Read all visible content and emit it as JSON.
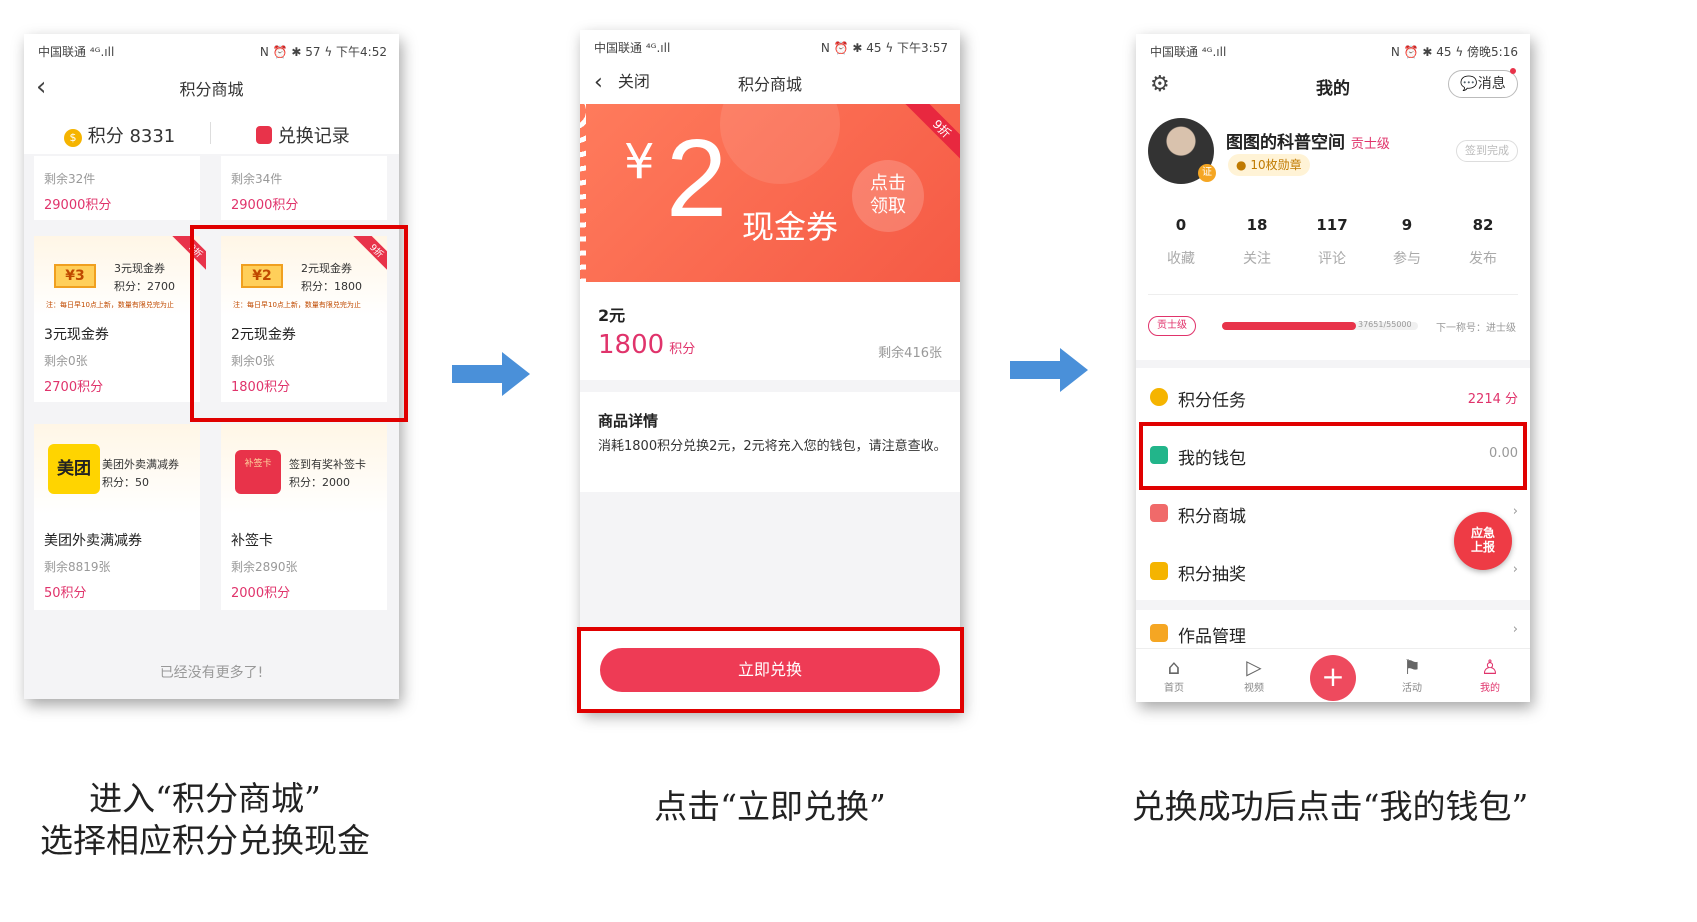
{
  "phone1": {
    "status_left": "中国联通 ⁴ᴳ.ıll",
    "status_right": "N ⏰ ✱ 57 ϟ 下午4:52",
    "title": "积分商城",
    "points_label": "积分 8331",
    "records_label": "兑换记录",
    "top_cells": [
      {
        "remain": "剩余32件",
        "price": "29000积分"
      },
      {
        "remain": "剩余34件",
        "price": "29000积分"
      }
    ],
    "items": [
      {
        "ticket": "¥3",
        "img_title": "3元现金券",
        "img_points": "积分：2700",
        "img_note": "注：每日早10点上新，数量有限兑完为止",
        "name": "3元现金券",
        "remain": "剩余0张",
        "price": "2700积分",
        "tag": "9折"
      },
      {
        "ticket": "¥2",
        "img_title": "2元现金券",
        "img_points": "积分：1800",
        "img_note": "注：每日早10点上新，数量有限兑完为止",
        "name": "2元现金券",
        "remain": "剩余0张",
        "price": "1800积分",
        "tag": "9折"
      },
      {
        "logo": "美团",
        "img_title": "美团外卖满减券",
        "img_points": "积分：50",
        "name": "美团外卖满减券",
        "remain": "剩余8819张",
        "price": "50积分"
      },
      {
        "card_label": "补签卡",
        "img_title": "签到有奖补签卡",
        "img_points": "积分：2000",
        "name": "补签卡",
        "remain": "剩余2890张",
        "price": "2000积分"
      }
    ],
    "end_text": "已经没有更多了!"
  },
  "phone2": {
    "status_left": "中国联通 ⁴ᴳ.ıll",
    "status_right": "N ⏰ ✱ 45 ϟ 下午3:57",
    "close_label": "关闭",
    "title": "积分商城",
    "banner_yen": "¥",
    "banner_amount": "2",
    "banner_text": "现金券",
    "banner_click_line1": "点击",
    "banner_click_line2": "领取",
    "banner_tag": "9折",
    "item_name": "2元",
    "points": "1800",
    "points_unit": "积分",
    "remain": "剩余416张",
    "detail_title": "商品详情",
    "detail_text": "消耗1800积分兑换2元，2元将充入您的钱包，请注意查收。",
    "redeem_button": "立即兑换"
  },
  "phone3": {
    "status_left": "中国联通 ⁴ᴳ.ıll",
    "status_right": "N ⏰ ✱ 45 ϟ 傍晚5:16",
    "title": "我的",
    "message_label": "消息",
    "username": "图图的科普空间",
    "level": "贡士级",
    "medals": "10枚勋章",
    "signin": "签到完成",
    "avatar_badge": "证",
    "stats": [
      {
        "num": "0",
        "label": "收藏"
      },
      {
        "num": "18",
        "label": "关注"
      },
      {
        "num": "117",
        "label": "评论"
      },
      {
        "num": "9",
        "label": "参与"
      },
      {
        "num": "82",
        "label": "发布"
      }
    ],
    "level_badge": "贡士级",
    "level_progress": "37651/55000",
    "level_progress_fraction": 0.684,
    "next_level": "下一称号：进士级",
    "menu": [
      {
        "label": "积分任务",
        "value": "2214 分",
        "color": "#f5b400"
      },
      {
        "label": "我的钱包",
        "value": "0.00",
        "color": "#22b58a"
      },
      {
        "label": "积分商城",
        "value": "",
        "color": "#f06a6a"
      },
      {
        "label": "积分抽奖",
        "value": "",
        "color": "#f5b400"
      }
    ],
    "works_label": "作品管理",
    "report_line1": "应急",
    "report_line2": "上报",
    "nav": [
      {
        "label": "首页",
        "icon": "home-icon"
      },
      {
        "label": "视频",
        "icon": "video-icon"
      },
      {
        "label": "",
        "icon": "plus-icon"
      },
      {
        "label": "活动",
        "icon": "flag-icon"
      },
      {
        "label": "我的",
        "icon": "user-icon"
      }
    ]
  },
  "captions": {
    "c1_line1": "进入“积分商城”",
    "c1_line2": "选择相应积分兑换现金",
    "c2": "点击“立即兑换”",
    "c3": "兑换成功后点击“我的钱包”"
  },
  "colors": {
    "accent": "#e0336b",
    "button": "#ee3b55",
    "highlight": "#e00000",
    "arrow": "#4a90d9"
  }
}
